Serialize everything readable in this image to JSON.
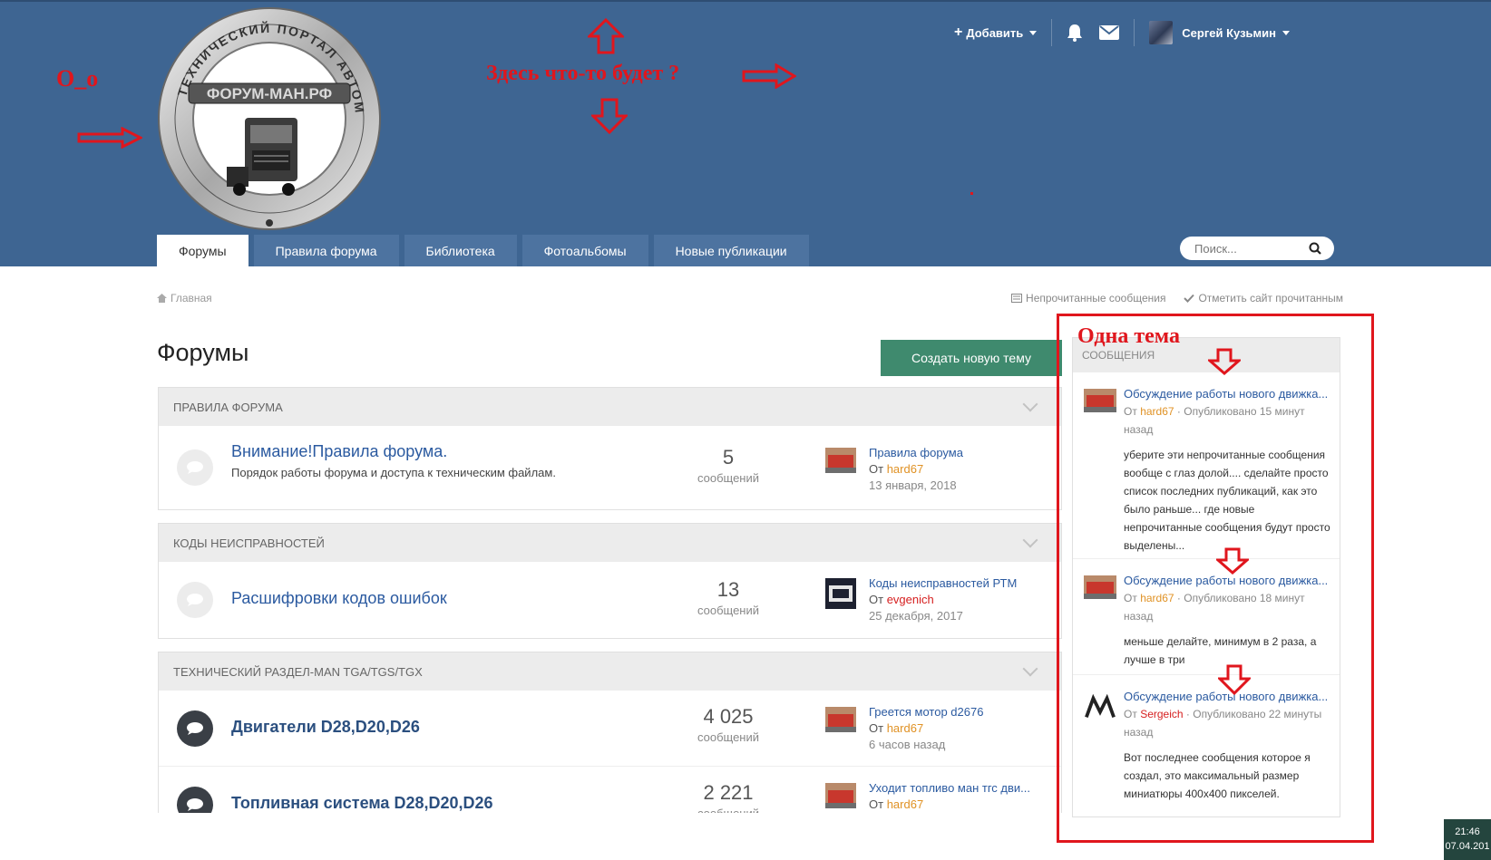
{
  "header": {
    "logo_text_top": "ТЕХНИЧЕСКИЙ ПОРТАЛ АВТОМОБИЛЕЙ MAN",
    "logo_banner": "ФОРУМ-МАН.РФ",
    "add_label": "Добавить",
    "user_name": "Сергей Кузьмин",
    "search_placeholder": "Поиск..."
  },
  "nav": {
    "tabs": [
      "Форумы",
      "Правила форума",
      "Библиотека",
      "Фотоальбомы",
      "Новые публикации"
    ]
  },
  "annotations": {
    "oo": "O_o",
    "here": "Здесь что-то будет ?",
    "one_topic": "Одна тема"
  },
  "breadcrumb": {
    "home": "Главная"
  },
  "toplinks": {
    "unread": "Непрочитанные сообщения",
    "mark_read": "Отметить сайт прочитанным"
  },
  "page": {
    "title": "Форумы",
    "create_button": "Создать новую тему"
  },
  "categories": [
    {
      "name": "Правила форума",
      "forums": [
        {
          "title": "Внимание!Правила форума.",
          "desc": "Порядок работы форума и доступа к техническим файлам.",
          "count": "5",
          "count_label": "сообщений",
          "last_title": "Правила форума",
          "last_by": "От",
          "last_user": "hard67",
          "last_date": "13 января, 2018"
        }
      ]
    },
    {
      "name": "Коды неисправностей",
      "forums": [
        {
          "title": "Расшифровки кодов ошибок",
          "desc": "",
          "count": "13",
          "count_label": "сообщений",
          "last_title": "Коды неисправностей РТМ",
          "last_by": "От",
          "last_user": "evgenich",
          "last_date": "25 декабря, 2017"
        }
      ]
    },
    {
      "name": "Технический раздел-MAN TGA/TGS/TGX",
      "forums": [
        {
          "title": "Двигатели D28,D20,D26",
          "desc": "",
          "count": "4 025",
          "count_label": "сообщений",
          "last_title": "Греется мотор d2676",
          "last_by": "От",
          "last_user": "hard67",
          "last_date": "6 часов назад"
        },
        {
          "title": "Топливная система D28,D20,D26",
          "desc": "",
          "count": "2 221",
          "count_label": "сообщений",
          "last_title": "Уходит топливо ман тгс дви...",
          "last_by": "От",
          "last_user": "hard67",
          "last_date": ""
        }
      ]
    }
  ],
  "sidebar": {
    "header": "Сообщения",
    "items": [
      {
        "title": "Обсуждение работы нового движка...",
        "by": "От",
        "user": "hard67",
        "meta": "· Опубликовано 15 минут назад",
        "text": "уберите эти непрочитанные сообщения вообще с глаз долой.... сделайте просто список последних публикаций, как это было раньше... где новые непрочитанные сообщения будут просто выделены..."
      },
      {
        "title": "Обсуждение работы нового движка...",
        "by": "От",
        "user": "hard67",
        "meta": "· Опубликовано 18 минут назад",
        "text": "меньше делайте, минимум в 2 раза, а лучше в три"
      },
      {
        "title": "Обсуждение работы нового движка...",
        "by": "От",
        "user": "Sergeich",
        "meta": "· Опубликовано 22 минуты назад",
        "text": "Вот последнее сообщения которое я создал, это максимальный размер миниатюры 400х400  пикселей."
      }
    ]
  },
  "clock": {
    "time": "21:46",
    "date": "07.04.201"
  },
  "colors": {
    "header": "#3e6592",
    "accent": "#3f8a6e",
    "annotation": "#e0161d"
  }
}
